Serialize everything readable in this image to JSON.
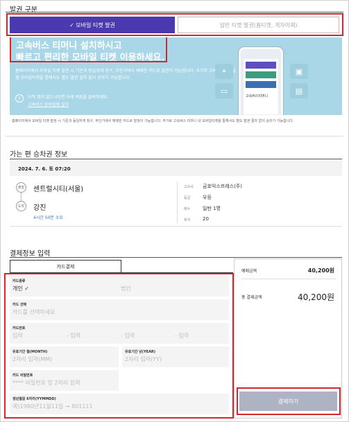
{
  "issue": {
    "title": "발권 구분",
    "mobile_btn": "✓ 모바일 티켓 발권",
    "paper_btn": "일반 티켓 발권(홈티켓, 게자이체)"
  },
  "banner": {
    "headline1": "고속버스 티머니 설치하시고",
    "headline2": "빠르고 편리한 모바일 티켓 이용하세요.",
    "desc": "홈페이지에서 모바일 티켓 발권 시 기존과 동일하게 창구, 무인기에서 예매한 카드로 발권이 가능합니다. 추가로 고속버스모바일 앱 모바일티켓을 통해서도 별도 발권 절차 없이 승차가 가능합니다.",
    "info": "아직 앱이 없으시다면 아래 버튼을 클릭하세요.",
    "link": "고속버스 모바일앱 설치",
    "phone_label": "고속버스티머니"
  },
  "note": "· 홈페이지에서 모바일 티켓 발권 시 기존과 동일하게 창구, 무인기에서 예매한 카드로 발권이 가능합니다. 추가로 고속버스 티머니 내 모바일티켓을 통해서도 별도 발권 절차 없이 승차가 가능합니다.",
  "trip": {
    "section_title": "가는 편 승차권 정보",
    "date": "2024. 7. 6. 토 07:20",
    "dep_tag": "출발",
    "dep_name": "센트럴시티(서울)",
    "arr_tag": "도착",
    "arr_name": "강진",
    "duration": "4시간 50분 소요",
    "meta": [
      {
        "label": "고속사",
        "value": "금호익스프레스(주)"
      },
      {
        "label": "등급",
        "value": "우등"
      },
      {
        "label": "매수",
        "value": "일반 1명"
      },
      {
        "label": "좌석",
        "value": "20"
      }
    ]
  },
  "payment": {
    "section_title": "결제정보 입력",
    "tab": "카드결제",
    "card_type": {
      "label": "카드종류",
      "personal": "개인 ✓",
      "corporate": "법인"
    },
    "card_select": {
      "label": "카드 선택",
      "placeholder": "카드를 선택하세요"
    },
    "card_number": {
      "label": "카드번호",
      "parts": [
        "입력",
        "- 입력",
        "- 입력",
        "- 입력"
      ]
    },
    "expiry_month": {
      "label": "유효기간 월(MONTH)",
      "placeholder": "2자리 입력(MM)"
    },
    "expiry_year": {
      "label": "유효기간 년(YEAR)",
      "placeholder": "2자리 입력(YY)"
    },
    "password": {
      "label": "카드 비밀번호",
      "placeholder": "**** 비밀번호 앞 2자리 입력"
    },
    "birth": {
      "label": "생년월일 6자리(YYMMDD)",
      "placeholder": "예)1980년11월11일 → 801111"
    },
    "summary": {
      "amount_label": "예매금액",
      "amount": "40,200원",
      "total_label": "총 결제금액",
      "total": "40,200원",
      "pay_btn": "결제하기"
    }
  },
  "colors": {
    "accent": "#4a3ab0",
    "highlight": "#d6262c",
    "banner": "#a9d7e7"
  }
}
